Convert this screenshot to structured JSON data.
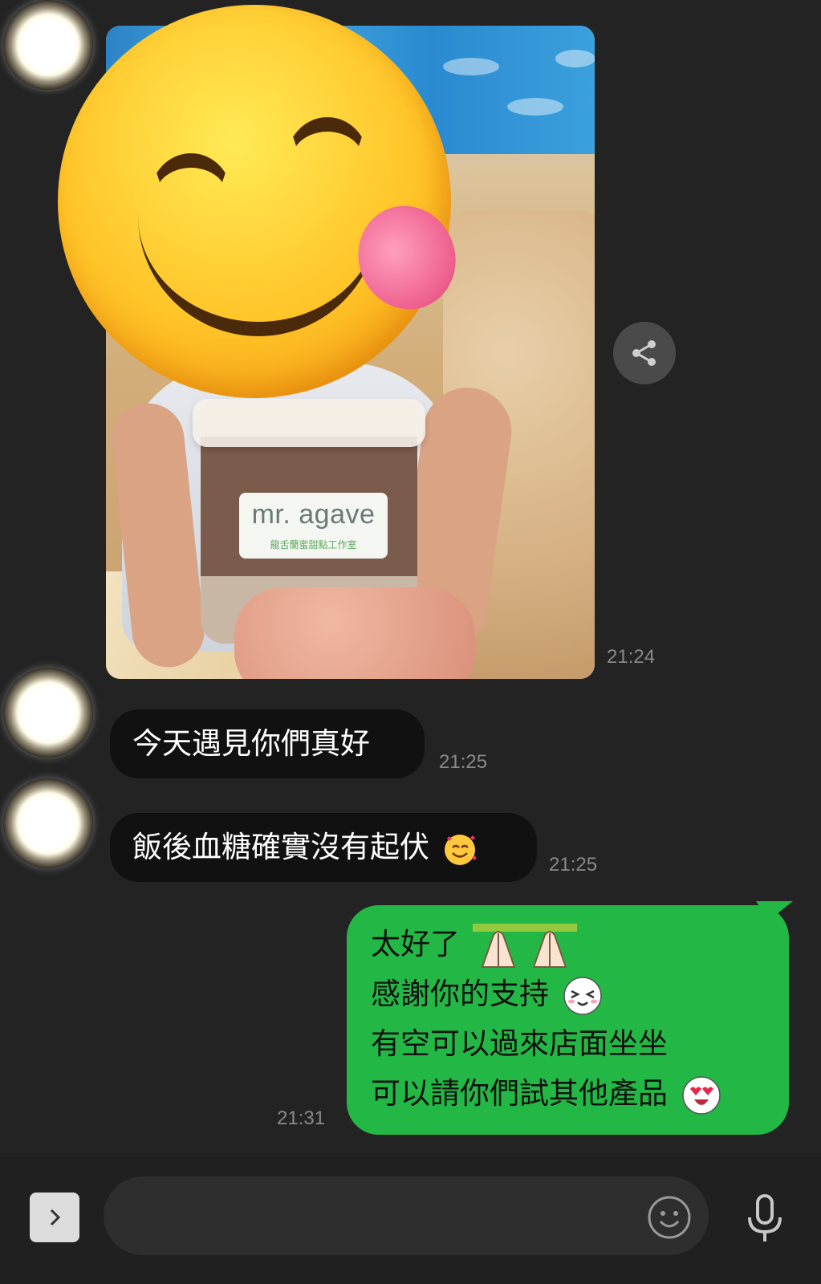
{
  "messages": {
    "photo": {
      "time": "21:24",
      "cup_brand": "mr. agave",
      "cup_sub": "龍舌蘭蜜甜點工作室"
    },
    "msg1": {
      "text": "今天遇見你們真好",
      "time": "21:25"
    },
    "msg2": {
      "text": "飯後血糖確實沒有起伏",
      "emoji": "smiling-face-with-hearts-icon",
      "time": "21:25"
    },
    "reply": {
      "lines": [
        "太好了",
        "感謝你的支持",
        "有空可以過來店面坐坐",
        "可以請你們試其他產品"
      ],
      "time": "21:31"
    }
  },
  "input": {
    "placeholder": ""
  },
  "colors": {
    "background": "#232323",
    "incoming_bubble": "#111111",
    "outgoing_bubble": "#23b846",
    "timestamp": "#8a8a8a"
  },
  "icons": [
    "share-icon",
    "chevron-right-icon",
    "smiley-icon",
    "microphone-icon",
    "praying-hands-icon",
    "laughing-face-icon",
    "heart-eyes-face-icon",
    "smiling-face-with-hearts-icon"
  ]
}
